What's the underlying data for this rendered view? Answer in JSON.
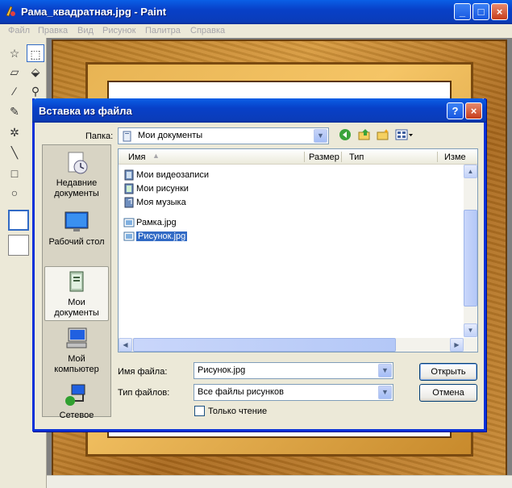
{
  "window": {
    "title": "Рама_квадратная.jpg - Paint",
    "minimize": "_",
    "maximize": "□",
    "close": "×"
  },
  "menu": [
    "Файл",
    "Правка",
    "Вид",
    "Рисунок",
    "Палитра",
    "Справка"
  ],
  "dialog": {
    "title": "Вставка из файла",
    "help": "?",
    "close": "×",
    "folder_label": "Папка:",
    "folder_value": "Мои документы",
    "places": [
      {
        "label": "Недавние документы",
        "icon": "recent-documents-icon"
      },
      {
        "label": "Рабочий стол",
        "icon": "desktop-icon"
      },
      {
        "label": "Мои документы",
        "icon": "my-documents-icon"
      },
      {
        "label": "Мой компьютер",
        "icon": "my-computer-icon"
      },
      {
        "label": "Сетевое",
        "icon": "network-icon"
      }
    ],
    "columns": {
      "name": "Имя",
      "size": "Размер",
      "type": "Тип",
      "modified": "Изме"
    },
    "folders": [
      "Мои видеозаписи",
      "Мои рисунки",
      "Моя музыка"
    ],
    "files": [
      "Рамка.jpg",
      "Рисунок.jpg"
    ],
    "selected_file": "Рисунок.jpg",
    "filename_label": "Имя файла:",
    "filename_value": "Рисунок.jpg",
    "filetype_label": "Тип файлов:",
    "filetype_value": "Все файлы рисунков",
    "readonly_label": "Только чтение",
    "open_button": "Открыть",
    "cancel_button": "Отмена"
  },
  "colors": {
    "titlebar": "#0a3cb8",
    "selection": "#316ac5",
    "dialog_bg": "#ece9d8"
  }
}
